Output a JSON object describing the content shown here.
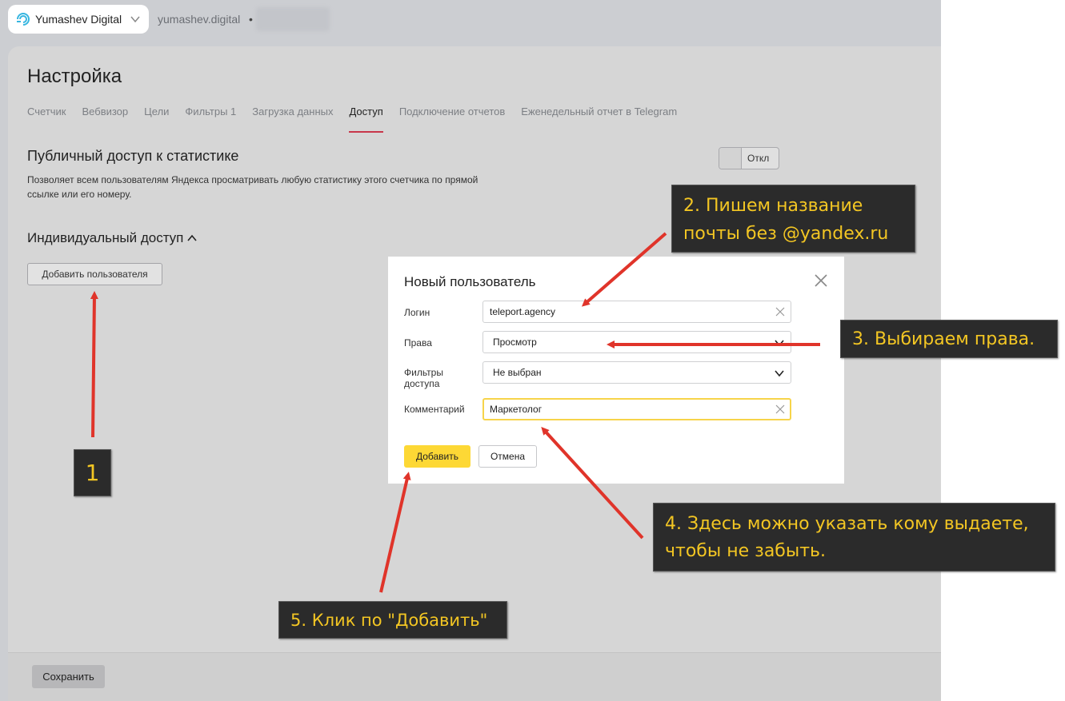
{
  "header": {
    "account_name": "Yumashev Digital",
    "site": "yumashev.digital",
    "site_separator": "•"
  },
  "page": {
    "title": "Настройка",
    "tabs": [
      {
        "label": "Счетчик",
        "active": false
      },
      {
        "label": "Вебвизор",
        "active": false
      },
      {
        "label": "Цели",
        "active": false
      },
      {
        "label": "Фильтры 1",
        "active": false
      },
      {
        "label": "Загрузка данных",
        "active": false
      },
      {
        "label": "Доступ",
        "active": true
      },
      {
        "label": "Подключение отчетов",
        "active": false
      },
      {
        "label": "Еженедельный отчет в Telegram",
        "active": false
      }
    ],
    "public_access": {
      "title": "Публичный доступ к статистике",
      "description": "Позволяет всем пользователям Яндекса просматривать любую статистику этого счетчика по прямой ссылке или его номеру.",
      "toggle_label": "Откл"
    },
    "individual_access": {
      "title": "Индивидуальный доступ",
      "add_user_button": "Добавить пользователя"
    },
    "save_button": "Сохранить"
  },
  "modal": {
    "title": "Новый пользователь",
    "login_label": "Логин",
    "login_value": "teleport.agency",
    "rights_label": "Права",
    "rights_value": "Просмотр",
    "filters_label": "Фильтры доступа",
    "filters_value": "Не выбран",
    "comment_label": "Комментарий",
    "comment_value": "Маркетолог",
    "add_button": "Добавить",
    "cancel_button": "Отмена"
  },
  "annotations": {
    "step1": "1",
    "step2": "2. Пишем название почты без @yandex.ru",
    "step3": "3. Выбираем права.",
    "step4": "4. Здесь можно указать кому выдаете, чтобы не забыть.",
    "step5": "5. Клик по \"Добавить\""
  },
  "colors": {
    "accent_tab_underline": "#c8374a",
    "primary_button": "#fdd835",
    "callout_text": "#f3c623",
    "callout_background": "#2b2b2b",
    "arrow": "#e0342a"
  }
}
